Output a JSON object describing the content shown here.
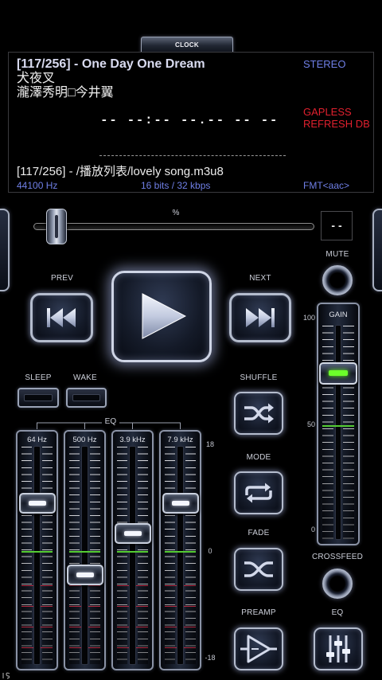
{
  "clock": {
    "label": "CLOCK"
  },
  "display": {
    "title": "[117/256] - One Day One Dream",
    "artist": "犬夜叉",
    "album": "瀧澤秀明□今井翼",
    "channels": "STEREO",
    "gapless": "GAPLESS",
    "refresh_db": "REFRESH DB",
    "time": "-- --:-- --.-- -- --",
    "path": "[117/256] - /播放列表/lovely song.m3u8",
    "sample_rate": "44100 Hz",
    "bit_info": "16 bits / 32 kbps",
    "format": "FMT<aac>"
  },
  "progress": {
    "unit_label": "%",
    "value": 0,
    "readout": "- -"
  },
  "transport": {
    "prev_label": "PREV",
    "next_label": "NEXT"
  },
  "mute": {
    "label": "MUTE"
  },
  "gain": {
    "label": "GAIN",
    "value": 74,
    "scale": [
      "100",
      "50",
      "0"
    ]
  },
  "timers": {
    "sleep_label": "SLEEP",
    "wake_label": "WAKE"
  },
  "eq": {
    "label": "EQ",
    "scale": [
      "18",
      "0",
      "-18"
    ],
    "bands": [
      {
        "label": "64 Hz",
        "value": 8
      },
      {
        "label": "500 Hz",
        "value": -4
      },
      {
        "label": "3.9 kHz",
        "value": 3
      },
      {
        "label": "7.9 kHz",
        "value": 8
      }
    ]
  },
  "controls": {
    "shuffle_label": "SHUFFLE",
    "mode_label": "MODE",
    "fade_label": "FADE",
    "preamp_label": "PREAMP",
    "crossfeed_label": "CROSSFEED",
    "eq_label": "EQ"
  },
  "colors": {
    "accent_blue": "#6f7fe6",
    "alert_red": "#e0202e",
    "gain_green": "#6cff2a"
  }
}
